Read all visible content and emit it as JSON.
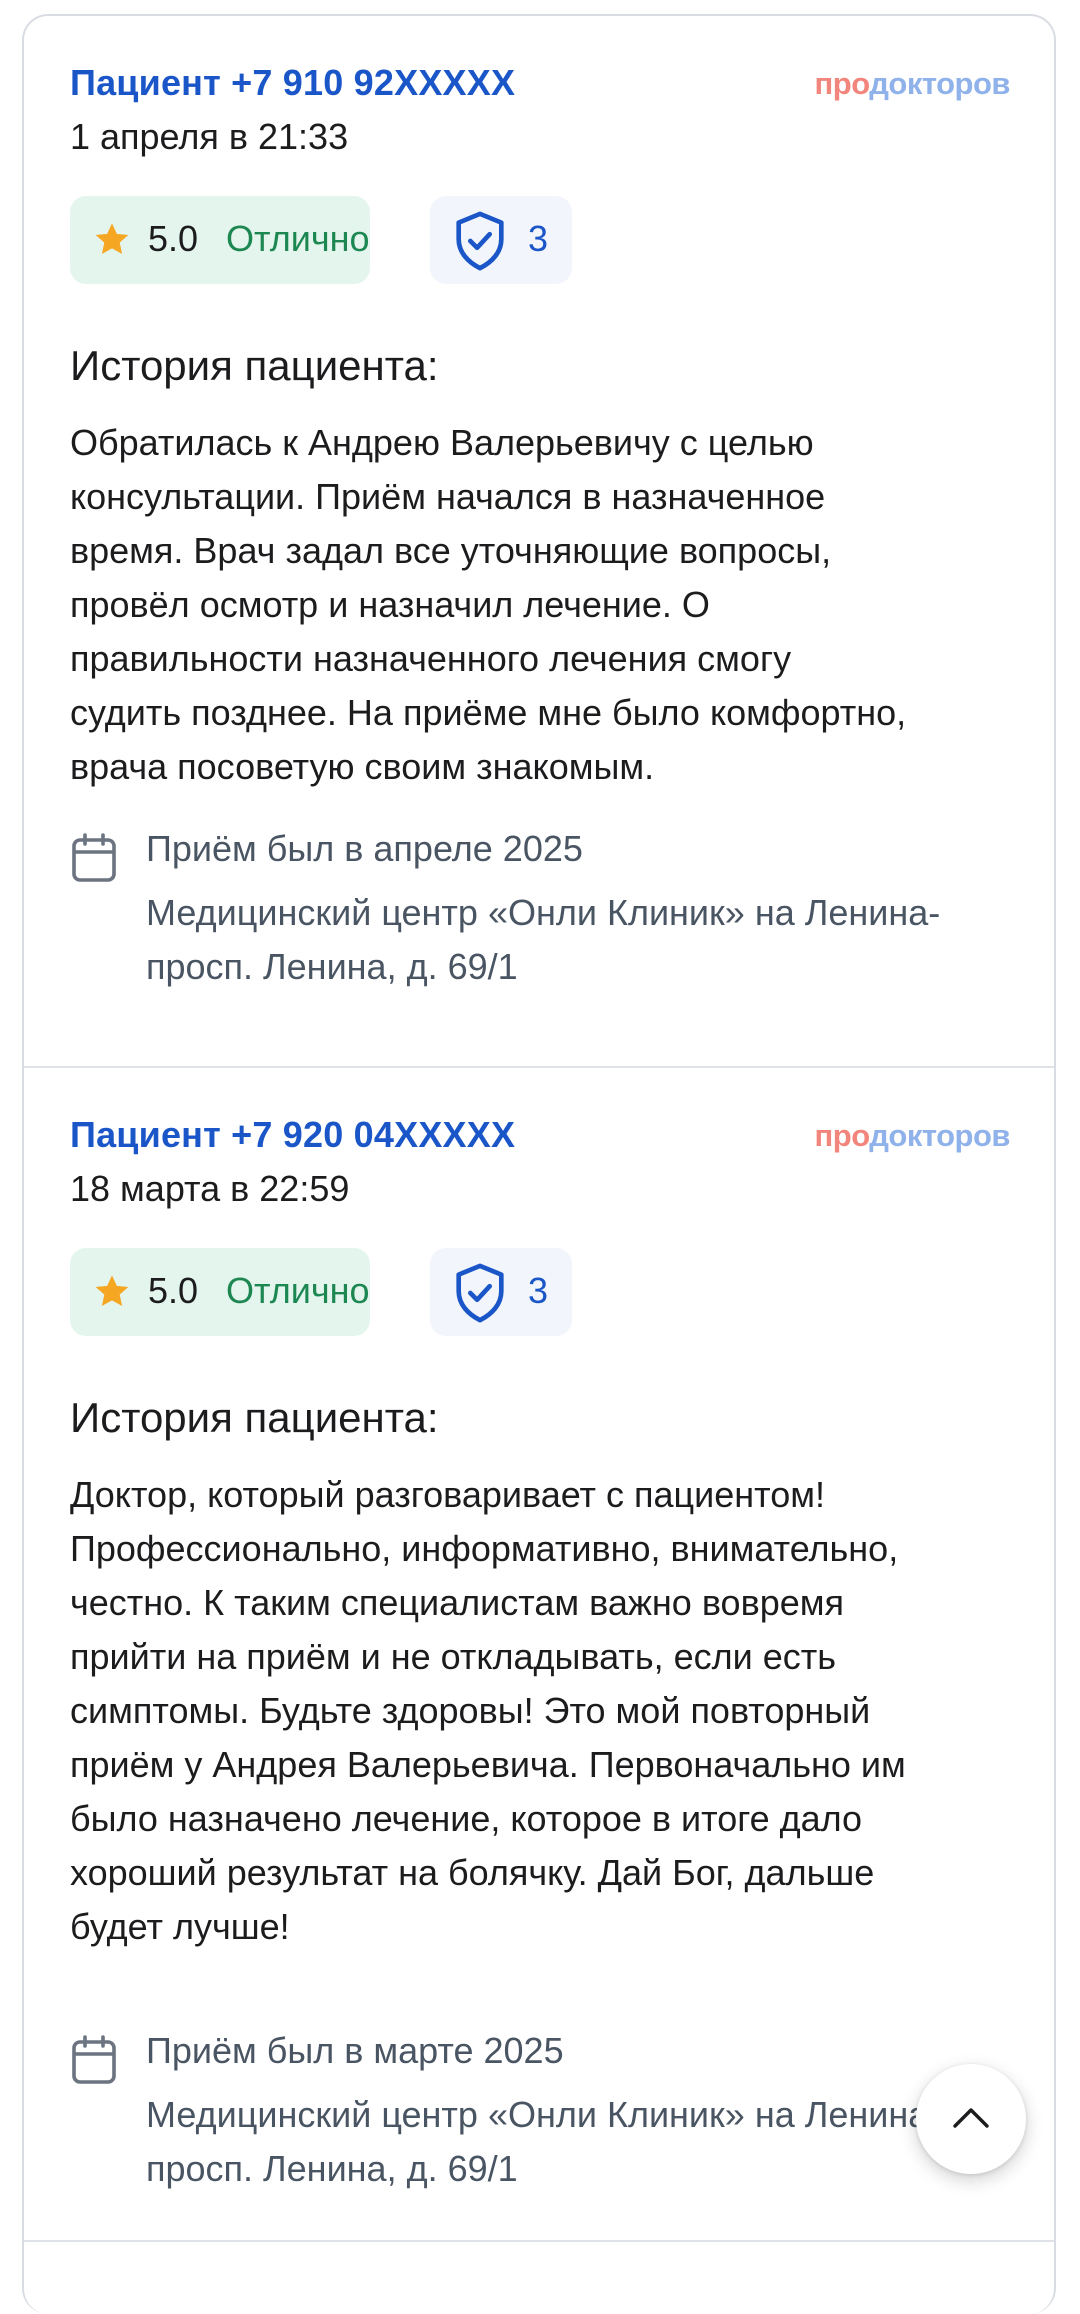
{
  "brand": {
    "logo_part1": "про",
    "logo_part2": "докторов"
  },
  "reviews": [
    {
      "author": "Пациент +7 910 92XXXXX",
      "date": "1 апреля в 21:33",
      "rating_value": "5.0",
      "rating_text": "Отлично",
      "verify_count": "3",
      "story_title": "История пациента:",
      "story_text": "Обратилась к Андрею Валерьевичу с целью\nконсультации. Приём начался в назначенное\nвремя. Врач задал все уточняющие вопросы,\nпровёл осмотр и назначил лечение. О\nправильности назначенного лечения смогу\nсудить позднее. На приёме мне было комфортно,\nврача посоветую своим знакомым.",
      "visit_date": "Приём был в апреле 2025",
      "visit_place": "Медицинский центр «Онли Клиник» на Ленина-просп. Ленина, д. 69/1"
    },
    {
      "author": "Пациент +7 920 04XXXXX",
      "date": "18 марта в 22:59",
      "rating_value": "5.0",
      "rating_text": "Отлично",
      "verify_count": "3",
      "story_title": "История пациента:",
      "story_text": "Доктор, который разговаривает с пациентом!\nПрофессионально, информативно, внимательно,\nчестно. К таким специалистам важно вовремя\nприйти на приём и не откладывать, если есть\nсимптомы. Будьте здоровы! Это мой повторный\nприём у Андрея Валерьевича. Первоначально им\nбыло назначено лечение, которое в итоге дало\nхороший результат на болячку. Дай Бог, дальше\nбудет лучше!",
      "visit_date": "Приём был в марте 2025",
      "visit_place": "Медицинский центр «Онли Клиник» на Ленина-просп. Ленина, д. 69/1"
    }
  ],
  "colors": {
    "author_link": "#1a56c8",
    "rating_bg": "#e3f5ec",
    "rating_text": "#1d8752",
    "star": "#f5a623",
    "logo_pro": "#f2857c",
    "logo_doc": "#8fb2ea"
  },
  "icons": [
    "star-icon",
    "shield-check-icon",
    "calendar-icon",
    "chevron-up-icon"
  ]
}
